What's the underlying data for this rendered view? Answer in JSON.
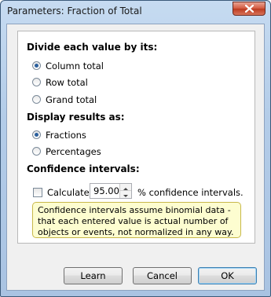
{
  "window": {
    "title": "Parameters: Fraction of Total"
  },
  "divide": {
    "heading": "Divide each value by its:",
    "options": [
      {
        "label": "Column total",
        "selected": true
      },
      {
        "label": "Row total",
        "selected": false
      },
      {
        "label": "Grand total",
        "selected": false
      }
    ]
  },
  "display": {
    "heading": "Display results as:",
    "options": [
      {
        "label": "Fractions",
        "selected": true
      },
      {
        "label": "Percentages",
        "selected": false
      }
    ]
  },
  "confidence": {
    "heading": "Confidence intervals:",
    "calculate_label": "Calculate",
    "calculate_checked": false,
    "level_value": "95.00",
    "suffix_label": "% confidence intervals.",
    "note": "Confidence intervals assume binomial data - that each entered value is actual number of objects or events, not normalized in any way."
  },
  "buttons": {
    "learn": "Learn",
    "cancel": "Cancel",
    "ok": "OK"
  }
}
